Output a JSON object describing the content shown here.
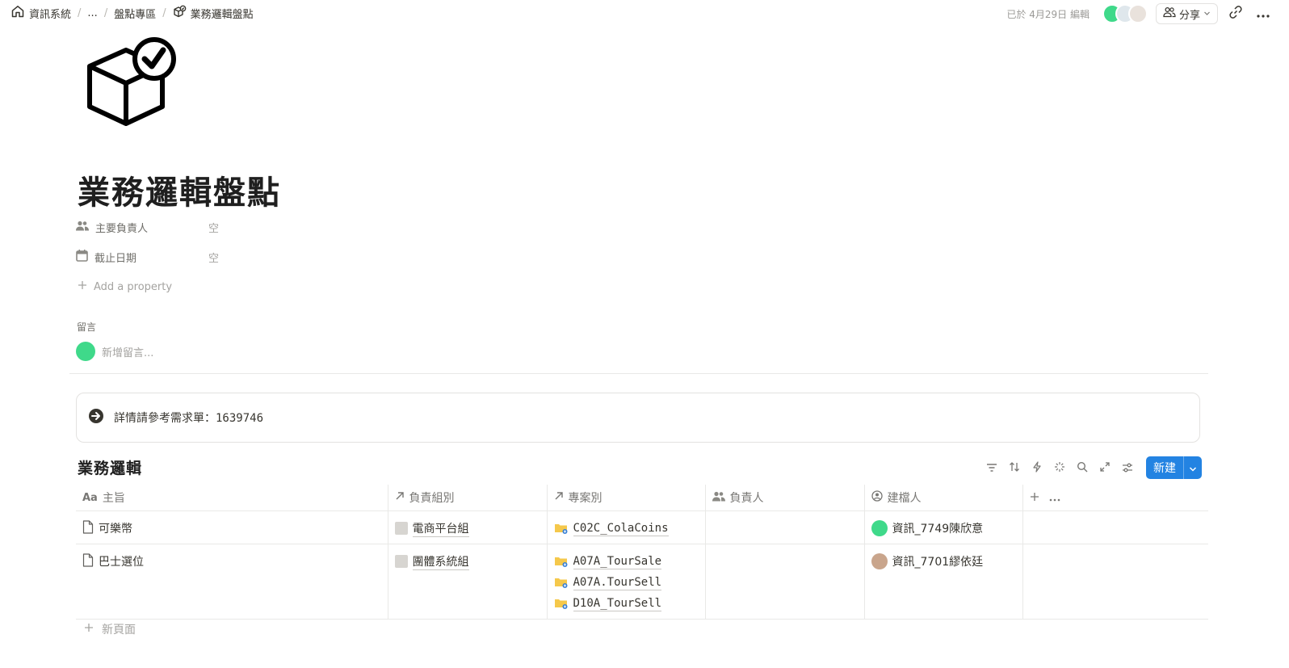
{
  "breadcrumb": {
    "items": [
      {
        "label": "資訊系統"
      },
      {
        "label": "..."
      },
      {
        "label": "盤點專區"
      },
      {
        "label": "業務邏輯盤點"
      }
    ]
  },
  "topbar": {
    "edited": "已於 4月29日 編輯",
    "share_label": "分享"
  },
  "page": {
    "title": "業務邏輯盤點"
  },
  "properties": [
    {
      "name": "主要負責人",
      "value": "空",
      "icon": "people-icon"
    },
    {
      "name": "截止日期",
      "value": "空",
      "icon": "calendar-icon"
    }
  ],
  "add_property": "Add a property",
  "comments": {
    "label": "留言",
    "placeholder": "新增留言..."
  },
  "callout": {
    "text": "詳情請參考需求單：1639746"
  },
  "database": {
    "title": "業務邏輯",
    "new_button": "新建",
    "columns": [
      {
        "icon": "Aa",
        "label": "主旨"
      },
      {
        "icon": "relation-arrow-icon",
        "label": "負責組別"
      },
      {
        "icon": "relation-arrow-icon",
        "label": "專案別"
      },
      {
        "icon": "people-icon",
        "label": "負責人"
      },
      {
        "icon": "person-icon",
        "label": "建檔人"
      }
    ],
    "rows": [
      {
        "title": "可樂幣",
        "group": "電商平台組",
        "projects": [
          "C02C_ColaCoins"
        ],
        "owner": "",
        "creator": "資訊_7749陳欣意"
      },
      {
        "title": "巴士選位",
        "group": "團體系統組",
        "projects": [
          "A07A_TourSale",
          "A07A.TourSell",
          "D10A_TourSell"
        ],
        "owner": "",
        "creator": "資訊_7701繆依廷"
      }
    ],
    "new_page": "新頁面"
  },
  "colors": {
    "accent": "#2383e2",
    "avatar_green": "#3fd98a"
  }
}
